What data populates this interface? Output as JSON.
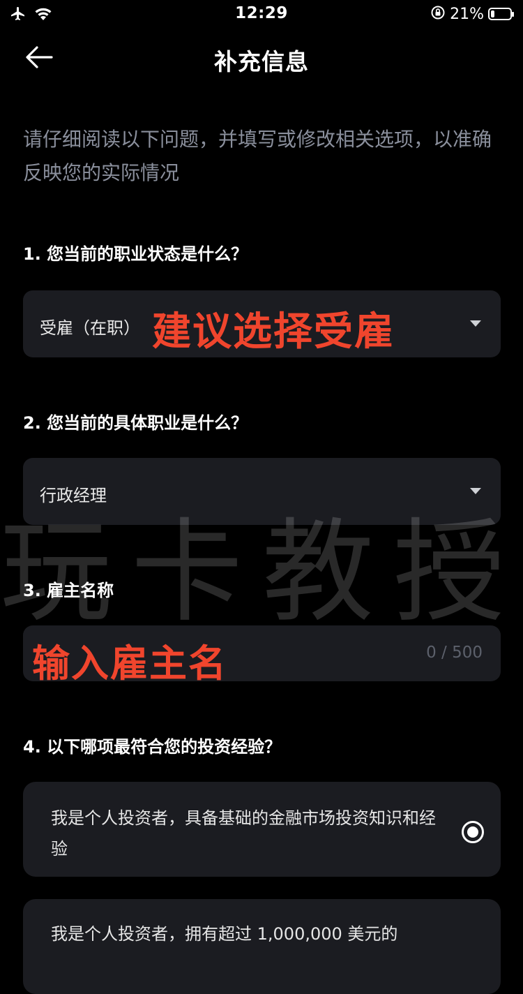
{
  "status_bar": {
    "time": "12:29",
    "battery_percent_text": "21%",
    "battery_level": 0.21,
    "icons": [
      "airplane-icon",
      "wifi-icon",
      "orientation-lock-icon",
      "battery-icon"
    ]
  },
  "nav": {
    "title": "补充信息",
    "back_icon": "back-arrow-icon"
  },
  "intro_text": "请仔细阅读以下问题，并填写或修改相关选项，以准确反映您的实际情况",
  "questions": [
    {
      "label": "1. 您当前的职业状态是什么？",
      "type": "select",
      "value": "受雇（在职）"
    },
    {
      "label": "2. 您当前的具体职业是什么？",
      "type": "select",
      "value": "行政经理"
    },
    {
      "label": "3. 雇主名称",
      "type": "text",
      "value": "",
      "counter": "0 / 500"
    },
    {
      "label": "4. 以下哪项最符合您的投资经验？",
      "type": "radio",
      "options": [
        {
          "text": "我是个人投资者，具备基础的金融市场投资知识和经验",
          "selected": true
        },
        {
          "text": "我是个人投资者，拥有超过 1,000,000 美元的",
          "selected": false
        }
      ]
    }
  ],
  "annotations": {
    "employment_hint": "建议选择受雇",
    "employer_hint": "输入雇主名"
  },
  "watermark": "玩卡教授",
  "colors": {
    "background": "#000000",
    "card": "#1b1c21",
    "muted_text": "#8a8f9c",
    "annotation_red": "#f0452d"
  }
}
